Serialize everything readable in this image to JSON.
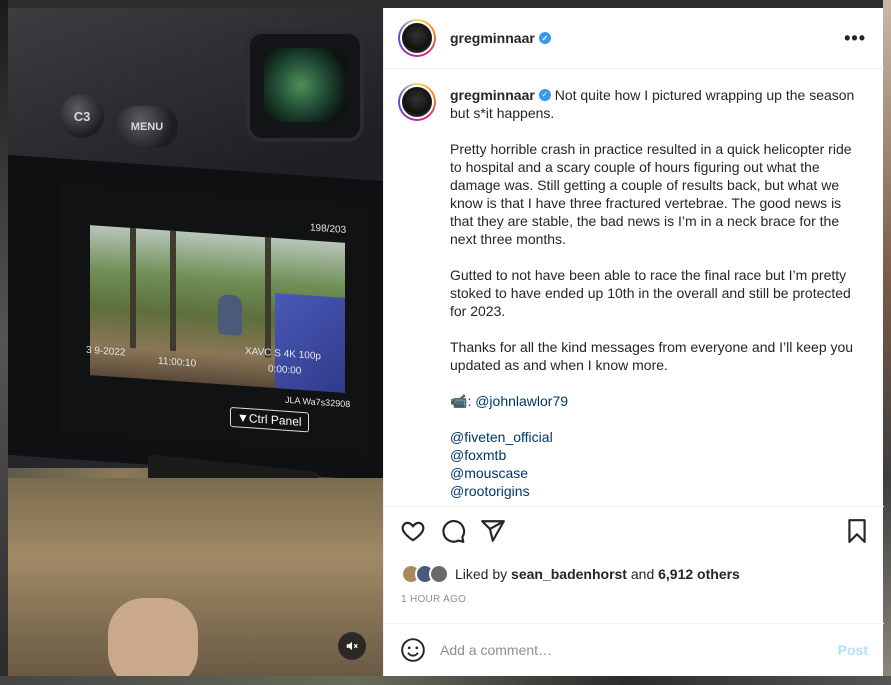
{
  "post": {
    "username": "gregminnaar",
    "verified_glyph": "✓",
    "more_icon": "•••",
    "caption": {
      "first_line": "Not quite how I pictured wrapping up the season but s*it happens.",
      "paragraph_2": "Pretty horrible crash in practice resulted in a quick helicopter ride to hospital and a scary couple of hours figuring out what the damage was. Still getting a couple of results back, but what we know is that I have three fractured vertebrae. The good news is that they are stable, the bad news is I’m in a neck brace for the next three months.",
      "paragraph_3": "Gutted to not have been able to race the final race but I’m pretty stoked to have ended up 10th in the overall and still be protected for 2023.",
      "paragraph_4": "Thanks for all the kind messages from everyone and I’ll keep you updated as and when I know more.",
      "video_credit_emoji": "📹",
      "video_credit_sep": ": ",
      "video_credit": "@johnlawlor79",
      "mentions": [
        "@fiveten_official",
        "@foxmtb",
        "@mouscase",
        "@rootorigins"
      ]
    },
    "likes": {
      "prefix": "Liked by",
      "user": "sean_badenhorst",
      "and": "and",
      "count": "6,912 others"
    },
    "timestamp": "1 HOUR AGO",
    "comment": {
      "placeholder": "Add a comment…",
      "post_label": "Post"
    },
    "icons": {
      "like": "heart-icon",
      "comment": "comment-icon",
      "share": "share-icon",
      "save": "bookmark-icon",
      "emoji": "emoji-icon",
      "mute": "mute-icon"
    }
  },
  "media": {
    "camera_screen": {
      "counter": "198/203",
      "date": "3 9-2022",
      "time": "11:00:10",
      "clip_info": "XAVC S 4K 100p",
      "timecode": "0:00:00",
      "file_name": "JLA Wa7s32908",
      "ctrl_panel": "▼Ctrl Panel",
      "btn_c3": "C3",
      "btn_menu": "MENU"
    }
  },
  "colors": {
    "link": "#00376b",
    "verified": "#3897f0",
    "post_disabled": "#b2dffc",
    "muted_text": "#8e8e8e",
    "text": "#262626"
  }
}
